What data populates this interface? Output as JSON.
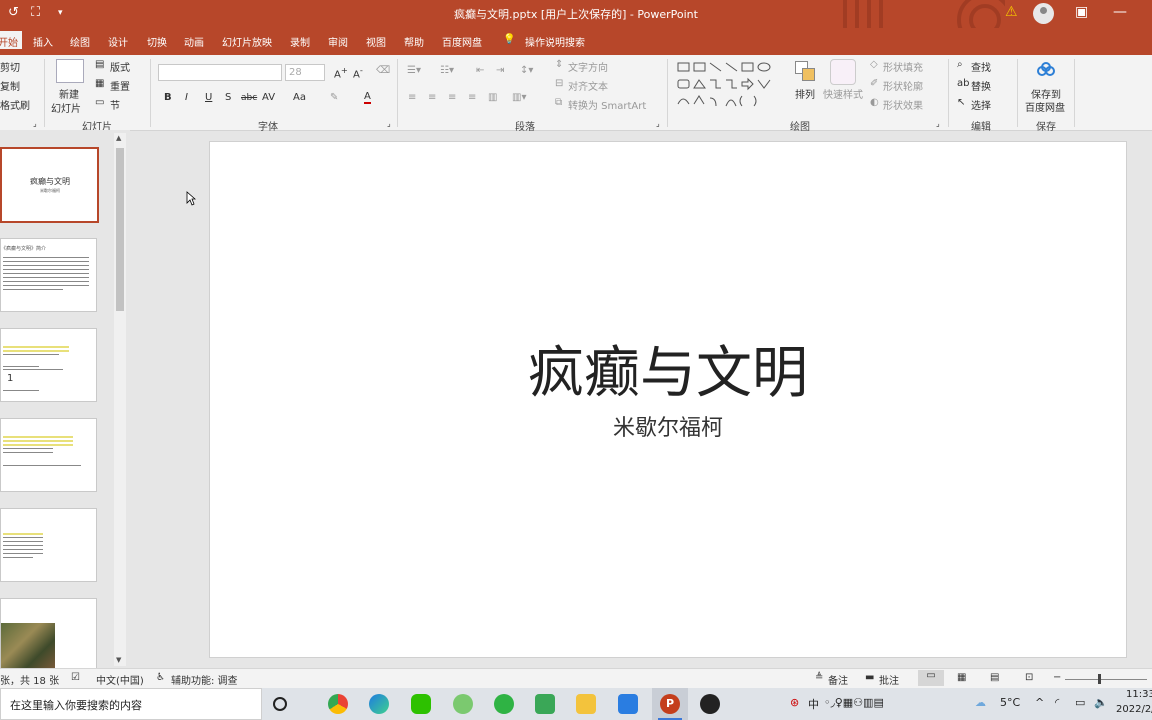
{
  "window": {
    "title": "疯癫与文明.pptx [用户上次保存的] - PowerPoint"
  },
  "tabs": [
    "开始",
    "插入",
    "绘图",
    "设计",
    "切换",
    "动画",
    "幻灯片放映",
    "录制",
    "审阅",
    "视图",
    "帮助",
    "百度网盘"
  ],
  "tell_me": "操作说明搜索",
  "ribbon": {
    "clipboard": {
      "cut": "剪切",
      "copy": "复制",
      "format_painter": "格式刷"
    },
    "slides": {
      "new_slide_1": "新建",
      "new_slide_2": "幻灯片",
      "layout": "版式",
      "reset": "重置",
      "section": "节",
      "group": "幻灯片"
    },
    "font": {
      "size": "28",
      "bold": "B",
      "italic": "I",
      "underline": "U",
      "shadow": "S",
      "strike": "abc",
      "spacing": "AV",
      "case": "Aa",
      "color": "A",
      "group": "字体"
    },
    "paragraph": {
      "text_direction": "文字方向",
      "align_text": "对齐文本",
      "smartart": "转换为 SmartArt",
      "group": "段落"
    },
    "drawing": {
      "arrange": "排列",
      "quick_styles": "快速样式",
      "fill": "形状填充",
      "outline": "形状轮廓",
      "effects": "形状效果",
      "group": "绘图"
    },
    "editing": {
      "find": "查找",
      "replace": "替换",
      "select": "选择",
      "group": "编辑"
    },
    "save": {
      "line1": "保存到",
      "line2": "百度网盘",
      "group": "保存"
    }
  },
  "thumbnails": [
    {
      "title": "疯癫与文明",
      "subtitle": "米歇尔福柯"
    },
    {
      "title": "《疯癫与文明》简介"
    },
    {
      "number": "1"
    },
    {},
    {},
    {}
  ],
  "slide": {
    "title": "疯癫与文明",
    "subtitle": "米歇尔福柯"
  },
  "status": {
    "slide_count": "张，共 18 张",
    "language": "中文(中国)",
    "accessibility": "辅助功能: 调查",
    "notes": "备注",
    "comments": "批注"
  },
  "taskbar": {
    "search_placeholder": "在这里输入你要搜索的内容",
    "temperature": "5°C",
    "ime_lang": "中",
    "time": "11:33",
    "date": "2022/2/"
  },
  "colors": {
    "accent": "#b7472a",
    "ribbon_bg": "#f3f3f3",
    "workspace_bg": "#e6e6e6"
  }
}
